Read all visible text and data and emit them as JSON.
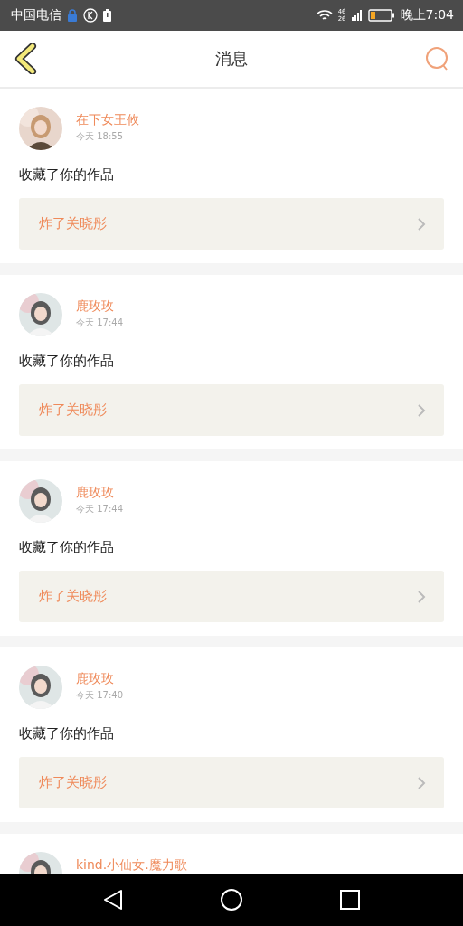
{
  "status_bar": {
    "carrier": "中国电信",
    "time": "晚上7:04",
    "network": "46\n26"
  },
  "header": {
    "title": "消息"
  },
  "messages": [
    {
      "user": "在下女王攸",
      "time": "今天 18:55",
      "action": "收藏了你的作品",
      "work": "炸了关晓彤"
    },
    {
      "user": "鹿玫玫",
      "time": "今天 17:44",
      "action": "收藏了你的作品",
      "work": "炸了关晓彤"
    },
    {
      "user": "鹿玫玫",
      "time": "今天 17:44",
      "action": "收藏了你的作品",
      "work": "炸了关晓彤"
    },
    {
      "user": "鹿玫玫",
      "time": "今天 17:40",
      "action": "收藏了你的作品",
      "work": "炸了关晓彤"
    },
    {
      "user": "kind.小仙女.魔力歌"
    }
  ]
}
